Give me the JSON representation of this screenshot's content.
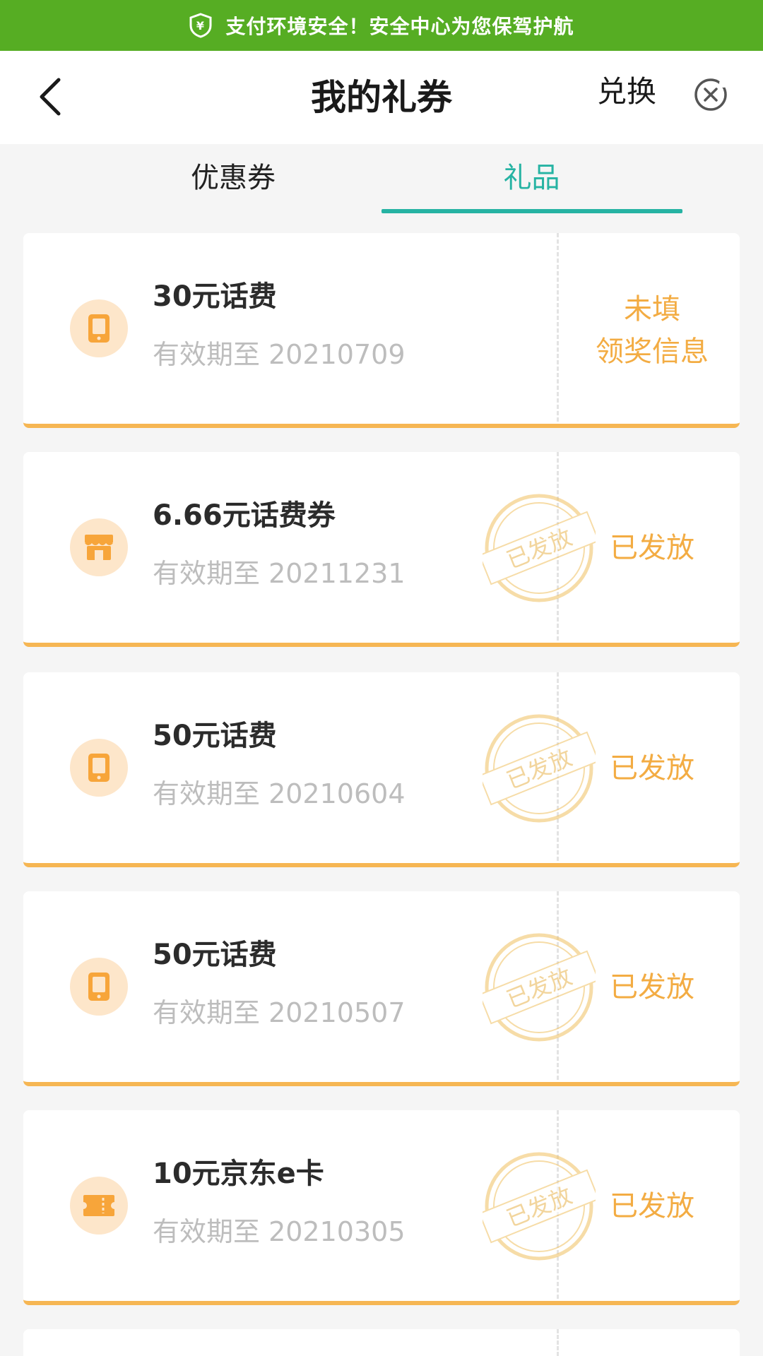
{
  "security_bar": {
    "text": "支付环境安全！安全中心为您保驾护航",
    "shield_icon": "shield-yuan-icon",
    "background_color": "#56ad23"
  },
  "header": {
    "title": "我的礼券",
    "exchange_label": "兑换",
    "back_icon": "chevron-left-icon",
    "close_icon": "close-circle-icon"
  },
  "tabs": [
    {
      "label": "优惠券",
      "active": false
    },
    {
      "label": "礼品",
      "active": true
    }
  ],
  "accent_color": "#26b3a3",
  "status_color": "#f3ac43",
  "cards": [
    {
      "name": "30元话费",
      "expiry": "有效期至 20210709",
      "icon": "phone-icon",
      "status_line1": "未填",
      "status_line2": "领奖信息",
      "stamped": false
    },
    {
      "name": "6.66元话费券",
      "expiry": "有效期至 20211231",
      "icon": "store-icon",
      "status": "已发放",
      "stamped": true,
      "stamp_text": "已发放"
    },
    {
      "name": "50元话费",
      "expiry": "有效期至 20210604",
      "icon": "phone-icon",
      "status": "已发放",
      "stamped": true,
      "stamp_text": "已发放"
    },
    {
      "name": "50元话费",
      "expiry": "有效期至 20210507",
      "icon": "phone-icon",
      "status": "已发放",
      "stamped": true,
      "stamp_text": "已发放"
    },
    {
      "name": "10元京东e卡",
      "expiry": "有效期至 20210305",
      "icon": "ticket-icon",
      "status": "已发放",
      "stamped": true,
      "stamp_text": "已发放"
    }
  ]
}
